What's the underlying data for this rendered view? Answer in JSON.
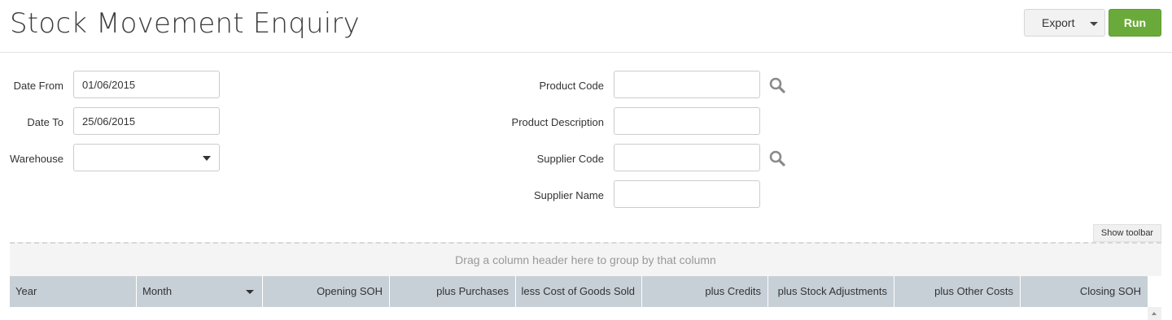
{
  "header": {
    "title": "Stock Movement Enquiry",
    "export_label": "Export",
    "run_label": "Run"
  },
  "filters": {
    "date_from": {
      "label": "Date From",
      "value": "01/06/2015"
    },
    "date_to": {
      "label": "Date To",
      "value": "25/06/2015"
    },
    "warehouse": {
      "label": "Warehouse",
      "value": ""
    },
    "product_code": {
      "label": "Product Code",
      "value": ""
    },
    "product_description": {
      "label": "Product Description",
      "value": ""
    },
    "supplier_code": {
      "label": "Supplier Code",
      "value": ""
    },
    "supplier_name": {
      "label": "Supplier Name",
      "value": ""
    }
  },
  "grid": {
    "show_toolbar_label": "Show toolbar",
    "group_panel_text": "Drag a column header here to group by that column",
    "columns": [
      {
        "label": "Year",
        "align": "left"
      },
      {
        "label": "Month",
        "align": "left",
        "sortable_caret": true
      },
      {
        "label": "Opening SOH",
        "align": "right"
      },
      {
        "label": "plus Purchases",
        "align": "right"
      },
      {
        "label": "less Cost of Goods Sold",
        "align": "right"
      },
      {
        "label": "plus Credits",
        "align": "right"
      },
      {
        "label": "plus Stock Adjustments",
        "align": "right"
      },
      {
        "label": "plus Other Costs",
        "align": "right"
      },
      {
        "label": "Closing SOH",
        "align": "right"
      }
    ]
  },
  "icons": {
    "search": "search-icon",
    "dropdown": "chevron-down-icon",
    "scroll_up": "scroll-up-arrow-icon"
  },
  "colors": {
    "run_button": "#6aaa3a",
    "grid_header": "#c7d0d7",
    "group_panel": "#f4f4f4"
  }
}
